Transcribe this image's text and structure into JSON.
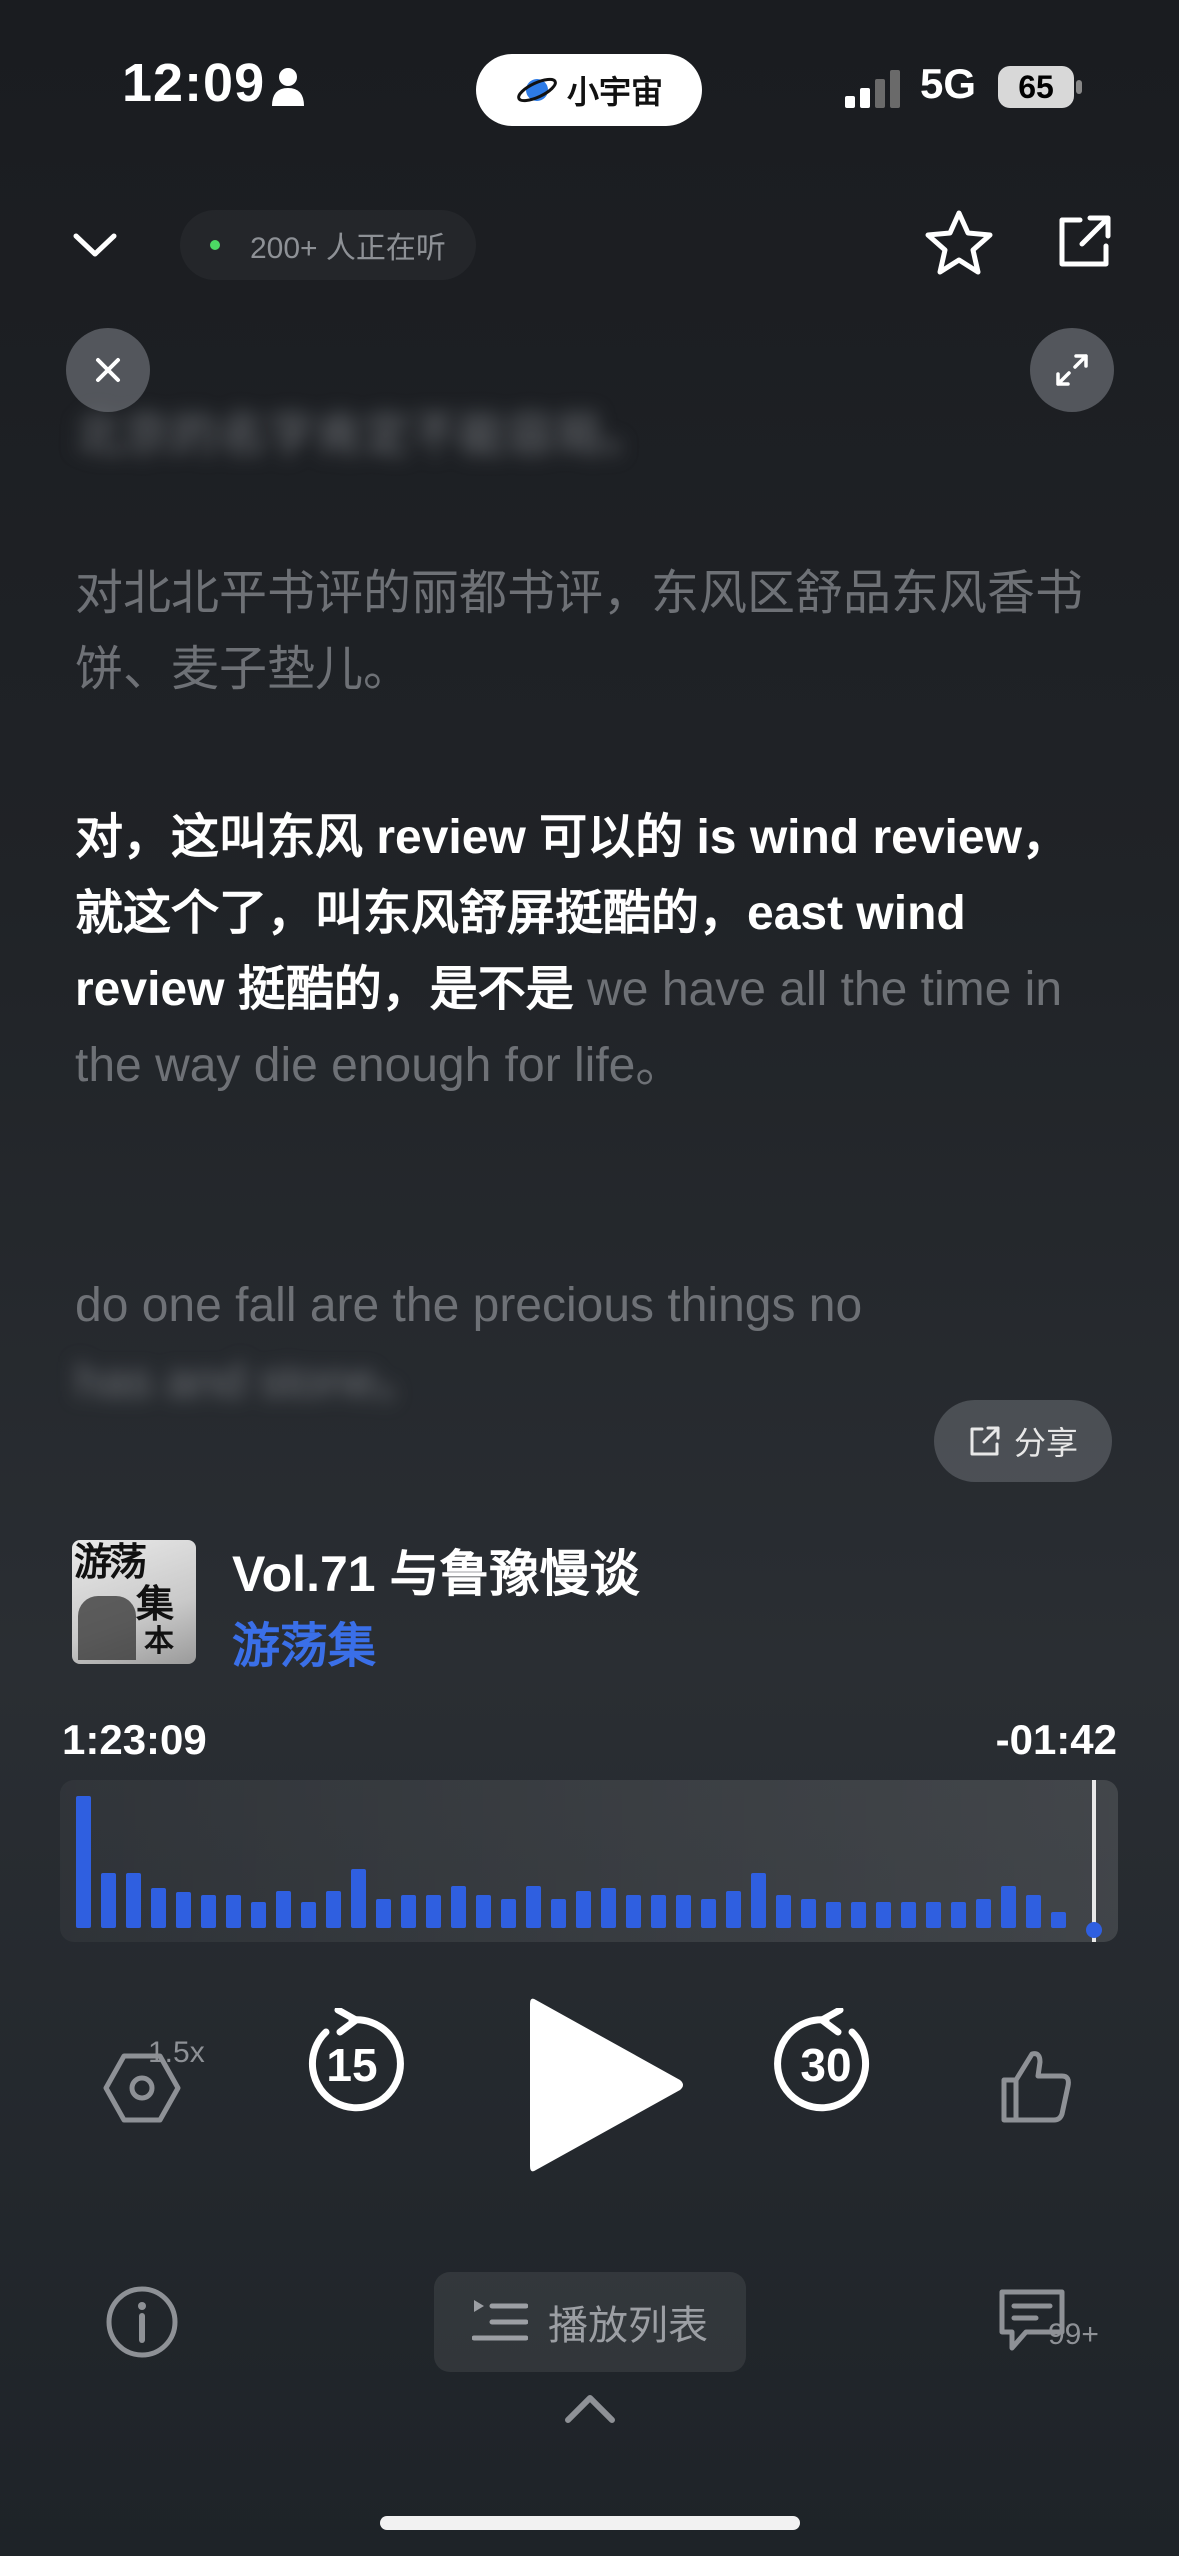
{
  "status_bar": {
    "time": "12:09",
    "app_pill": "小宇宙",
    "network": "5G",
    "battery": "65"
  },
  "header": {
    "listeners": "200+ 人正在听"
  },
  "transcript": {
    "blurred_top": "北京的名字肯定不能容局。",
    "line_1": "对北北平书评的丽都书评，东风区舒品东风香书饼、麦子垫儿。",
    "active_spoken": "对，这叫东风 review 可以的 is wind review，就这个了，叫东风舒屏挺酷的，east wind review 挺酷的，是不是",
    "active_rest": " we have all the time in the way die enough for life。",
    "line_3": "do one fall are the precious things no",
    "blurred_bottom": "has and stone。",
    "share_label": "分享"
  },
  "episode": {
    "cover_text_1": "游荡",
    "cover_text_2": "集",
    "cover_text_3": "本",
    "title": "Vol.71 与鲁豫慢谈",
    "show": "游荡集"
  },
  "progress": {
    "elapsed": "1:23:09",
    "remaining": "-01:42",
    "fraction": 0.985,
    "waveform_levels": [
      1.0,
      0.42,
      0.42,
      0.3,
      0.27,
      0.25,
      0.25,
      0.2,
      0.28,
      0.2,
      0.28,
      0.45,
      0.22,
      0.25,
      0.25,
      0.32,
      0.25,
      0.22,
      0.32,
      0.22,
      0.28,
      0.3,
      0.25,
      0.25,
      0.25,
      0.22,
      0.28,
      0.42,
      0.25,
      0.22,
      0.2,
      0.2,
      0.2,
      0.2,
      0.2,
      0.2,
      0.22,
      0.32,
      0.25,
      0.12
    ]
  },
  "controls": {
    "speed": "1.5x",
    "rewind_seconds": "15",
    "forward_seconds": "30",
    "playlist_label": "播放列表",
    "comment_count": "99+"
  },
  "colors": {
    "accent": "#2f5fe0",
    "show_link": "#3a6fe8",
    "live_dot": "#4cd964"
  }
}
